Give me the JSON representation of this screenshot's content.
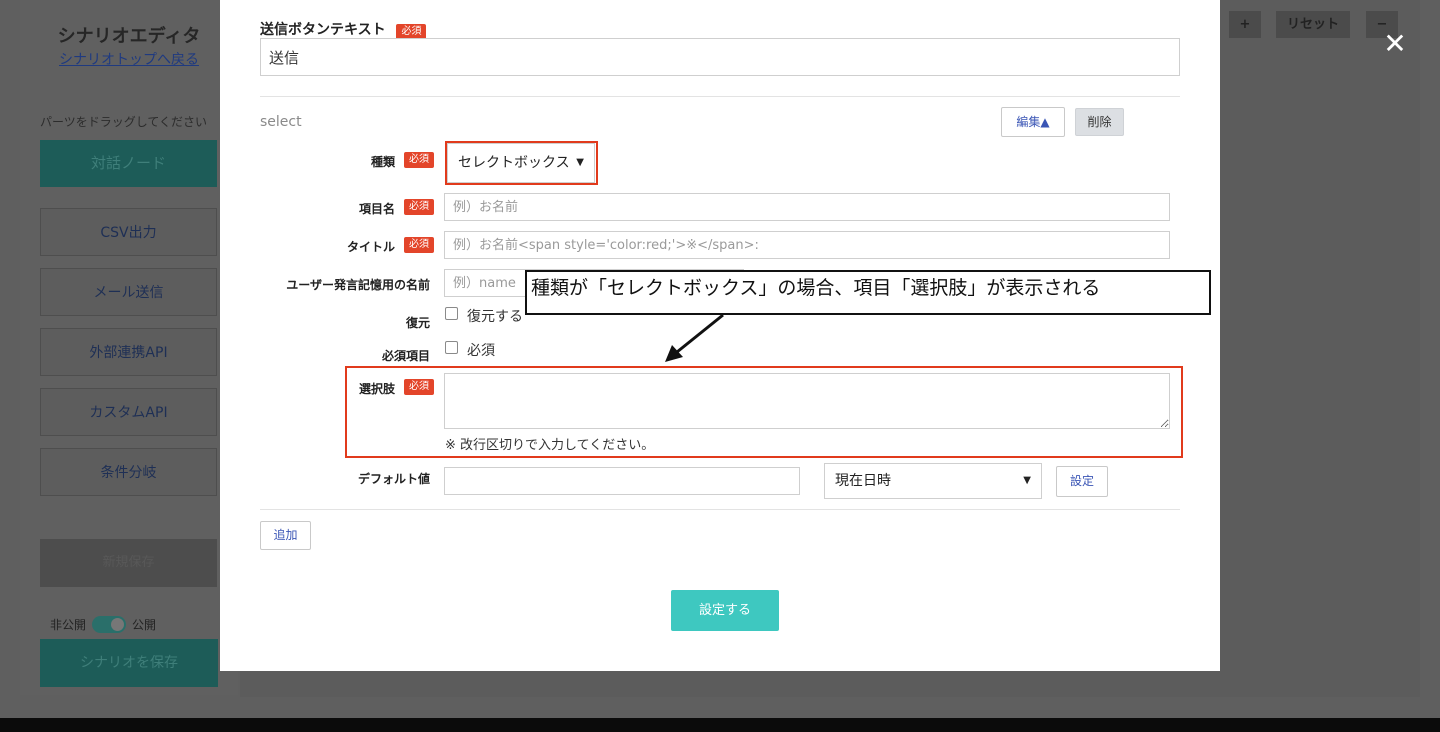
{
  "sidebar": {
    "title": "シナリオエディタ",
    "back_link": "シナリオトップへ戻る",
    "drag_hint": "パーツをドラッグしてください",
    "node_button": "対話ノード",
    "parts": [
      "CSV出力",
      "メール送信",
      "外部連携API",
      "カスタムAPI",
      "条件分岐"
    ],
    "disabled_button": "新規保存",
    "toggle_off_label": "非公開",
    "toggle_on_label": "公開",
    "save_button": "シナリオを保存"
  },
  "toolbar": {
    "plus_label": "+",
    "reset_label": "リセット",
    "minus_label": "−"
  },
  "modal": {
    "close_label": "✕",
    "submit_text_label": "送信ボタンテキスト",
    "required_badge": "必須",
    "submit_text_value": "送信",
    "section_label": "select",
    "edit_button": "編集▲",
    "delete_button": "削除",
    "type_label": "種類",
    "type_value": "セレクトボックス",
    "item_name_label": "項目名",
    "item_name_placeholder": "例）お名前",
    "title_label": "タイトル",
    "title_placeholder": "例）お名前<span style='color:red;'>※</span>:",
    "user_memory_label": "ユーザー発言記憶用の名前",
    "user_memory_placeholder": "例）name",
    "restore_label": "復元",
    "restore_checkbox_label": "復元する",
    "required_item_label": "必須項目",
    "required_checkbox_label": "必須",
    "choices_label": "選択肢",
    "choices_hint": "※ 改行区切りで入力してください。",
    "default_label": "デフォルト値",
    "default_select_value": "現在日時",
    "set_button": "設定",
    "add_button": "追加",
    "confirm_button": "設定する",
    "accent_color": "#3ec8c0",
    "required_color": "#e3452a"
  },
  "annotation": {
    "text": "種類が「セレクトボックス」の場合、項目「選択肢」が表示される",
    "highlight_color": "#e13a1c"
  }
}
